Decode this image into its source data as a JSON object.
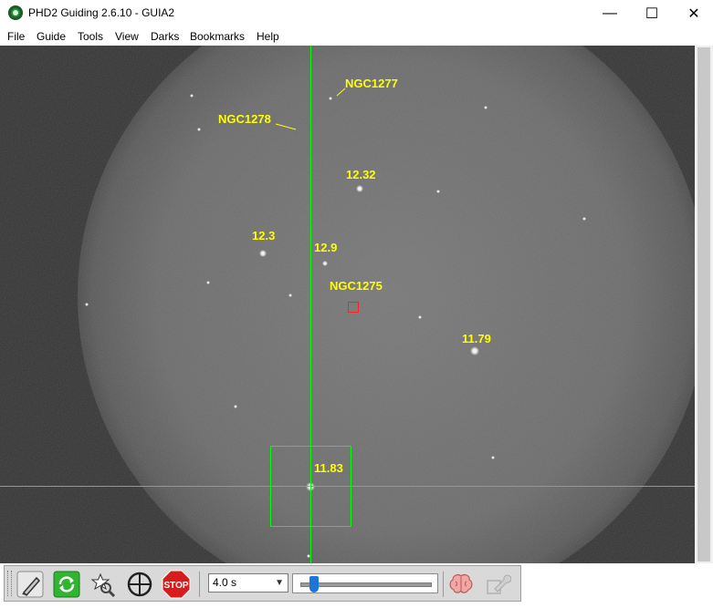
{
  "window": {
    "title": "PHD2 Guiding 2.6.10 - GUIA2",
    "controls": {
      "minimize": "—",
      "maximize": "☐",
      "close": "✕"
    }
  },
  "menu": [
    "File",
    "Guide",
    "Tools",
    "View",
    "Darks",
    "Bookmarks",
    "Help"
  ],
  "image_annotations": {
    "ngc1277": "NGC1277",
    "ngc1278": "NGC1278",
    "mag_1232": "12.32",
    "mag_123": "12.3",
    "mag_129": "12.9",
    "ngc1275": "NGC1275",
    "mag_1179": "11.79",
    "mag_1183": "11.83"
  },
  "toolbar": {
    "exposure_value": "4.0 s",
    "buttons": [
      "use-camera-icon",
      "loop-icon",
      "auto-select-star-icon",
      "guide-icon",
      "stop-icon",
      "brain-icon",
      "settings-wrench-icon"
    ]
  },
  "colors": {
    "annotation": "#ffff00",
    "crosshair": "#00ff00",
    "selection_box": "#ff2020",
    "loop_green": "#2fb52f",
    "stop_red": "#d81b1b"
  }
}
